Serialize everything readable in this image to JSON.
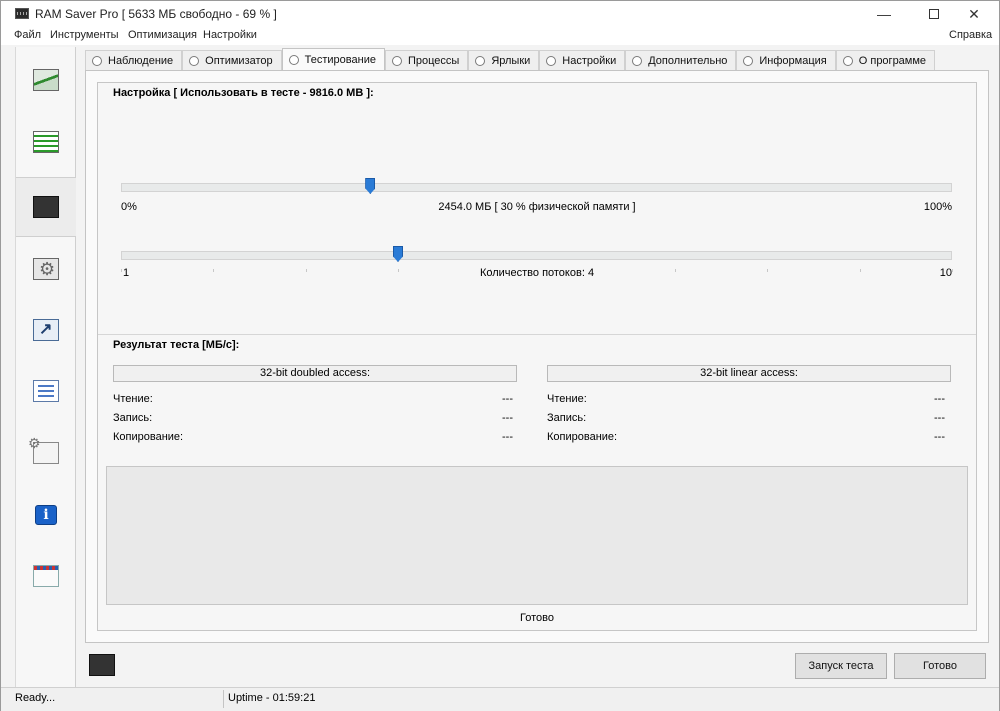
{
  "window": {
    "title": "RAM Saver Pro [ 5633 МБ свободно - 69 % ]",
    "minimize": "—",
    "close": "✕"
  },
  "menu": {
    "items": [
      "Файл",
      "Инструменты",
      "Оптимизация",
      "Настройки"
    ],
    "help": "Справка"
  },
  "sidebar": {
    "items": [
      {
        "name": "sidebar-monitor",
        "icon": "chart-icon"
      },
      {
        "name": "sidebar-optimizer",
        "icon": "list-icon"
      },
      {
        "name": "sidebar-testing",
        "icon": "memory-chip-icon",
        "active": true
      },
      {
        "name": "sidebar-processes",
        "icon": "gear-icon"
      },
      {
        "name": "sidebar-shortcuts",
        "icon": "shortcut-icon"
      },
      {
        "name": "sidebar-settings",
        "icon": "checklist-icon"
      },
      {
        "name": "sidebar-advanced",
        "icon": "settings-gear-icon"
      },
      {
        "name": "sidebar-information",
        "icon": "info-icon"
      },
      {
        "name": "sidebar-about",
        "icon": "mail-icon"
      }
    ]
  },
  "tabs": [
    {
      "label": "Наблюдение"
    },
    {
      "label": "Оптимизатор"
    },
    {
      "label": "Тестирование",
      "active": true
    },
    {
      "label": "Процессы"
    },
    {
      "label": "Ярлыки"
    },
    {
      "label": "Настройки"
    },
    {
      "label": "Дополнительно"
    },
    {
      "label": "Информация"
    },
    {
      "label": "О программе"
    }
  ],
  "settings": {
    "title": "Настройка [ Использовать в тесте - 9816.0 MB ]:",
    "memory_slider": {
      "fraction": 0.3,
      "min_label": "0%",
      "max_label": "100%",
      "value_label": "2454.0 МБ [ 30 % физической памяти ]"
    },
    "threads_slider": {
      "value": 4,
      "min": 1,
      "max": 10,
      "min_label": "1",
      "max_label": "10",
      "value_label": "Количество потоков: 4"
    }
  },
  "results": {
    "title": "Результат теста [МБ/с]:",
    "doubled": {
      "header": "32-bit doubled access:",
      "read_label": "Чтение:",
      "read_value": "---",
      "write_label": "Запись:",
      "write_value": "---",
      "copy_label": "Копирование:",
      "copy_value": "---"
    },
    "linear": {
      "header": "32-bit linear access:",
      "read_label": "Чтение:",
      "read_value": "---",
      "write_label": "Запись:",
      "write_value": "---",
      "copy_label": "Копирование:",
      "copy_value": "---"
    }
  },
  "status_text": "Готово",
  "buttons": {
    "run_test": "Запуск теста",
    "done": "Готово"
  },
  "statusbar": {
    "left": "Ready...",
    "uptime": "Uptime - 01:59:21"
  }
}
